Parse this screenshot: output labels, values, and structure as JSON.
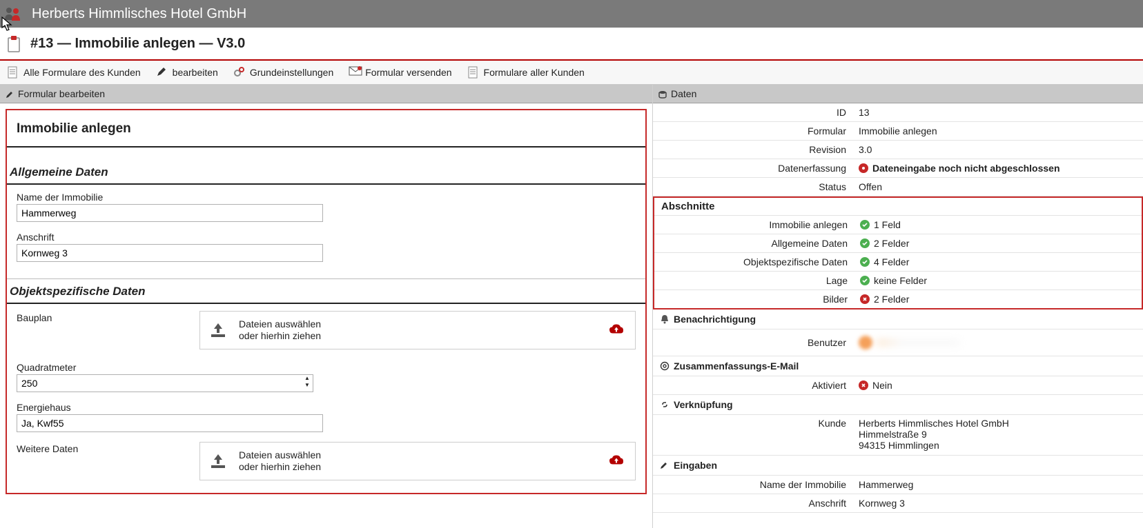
{
  "topbar": {
    "company": "Herberts Himmlisches Hotel GmbH"
  },
  "page_title": "#13 — Immobilie anlegen — V3.0",
  "toolbar": {
    "all_forms": "Alle Formulare des Kunden",
    "edit": "bearbeiten",
    "settings": "Grundeinstellungen",
    "send": "Formular versenden",
    "all_customers": "Formulare aller Kunden"
  },
  "panels": {
    "left_title": "Formular bearbeiten",
    "right_title": "Daten"
  },
  "form": {
    "title": "Immobilie anlegen",
    "section_allgemein": {
      "heading": "Allgemeine Daten",
      "name_label": "Name der Immobilie",
      "name_value": "Hammerweg",
      "anschrift_label": "Anschrift",
      "anschrift_value": "Kornweg 3"
    },
    "section_objekt": {
      "heading": "Objektspezifische Daten",
      "bauplan_label": "Bauplan",
      "dropzone_line1": "Dateien auswählen",
      "dropzone_line2": "oder hierhin ziehen",
      "qm_label": "Quadratmeter",
      "qm_value": "250",
      "energie_label": "Energiehaus",
      "energie_value": "Ja, Kwf55",
      "weitere_label": "Weitere Daten"
    }
  },
  "data_panel": {
    "id_label": "ID",
    "id_value": "13",
    "formular_label": "Formular",
    "formular_value": "Immobilie anlegen",
    "revision_label": "Revision",
    "revision_value": "3.0",
    "erfassung_label": "Datenerfassung",
    "erfassung_value": "Dateneingabe noch nicht abgeschlossen",
    "status_label": "Status",
    "status_value": "Offen",
    "abschnitte_heading": "Abschnitte",
    "abschnitte": [
      {
        "label": "Immobilie anlegen",
        "ok": true,
        "text": "1 Feld"
      },
      {
        "label": "Allgemeine Daten",
        "ok": true,
        "text": "2 Felder"
      },
      {
        "label": "Objektspezifische Daten",
        "ok": true,
        "text": "4 Felder"
      },
      {
        "label": "Lage",
        "ok": true,
        "text": "keine Felder"
      },
      {
        "label": "Bilder",
        "ok": false,
        "text": "2 Felder"
      }
    ],
    "notif_heading": "Benachrichtigung",
    "notif_user_label": "Benutzer",
    "email_heading": "Zusammenfassungs-E-Mail",
    "email_aktiviert_label": "Aktiviert",
    "email_aktiviert_value": "Nein",
    "link_heading": "Verknüpfung",
    "kunde_label": "Kunde",
    "kunde_name": "Herberts Himmlisches Hotel GmbH",
    "kunde_addr1": "Himmelstraße 9",
    "kunde_addr2": "94315 Himmlingen",
    "eingaben_heading": "Eingaben",
    "eingaben_name_label": "Name der Immobilie",
    "eingaben_name_value": "Hammerweg",
    "eingaben_anschrift_label": "Anschrift",
    "eingaben_anschrift_value": "Kornweg 3"
  }
}
